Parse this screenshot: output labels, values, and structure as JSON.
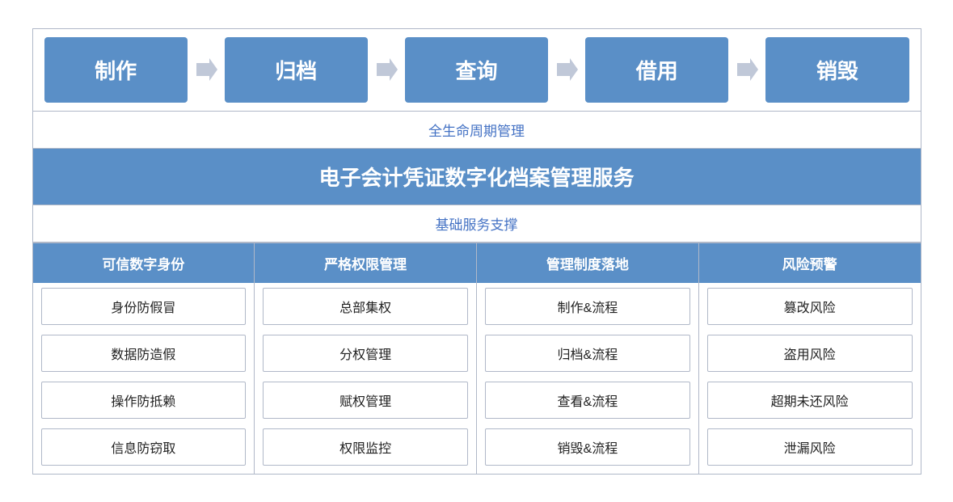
{
  "flow": {
    "steps": [
      "制作",
      "归档",
      "查询",
      "借用",
      "销毁"
    ]
  },
  "lifecycle_label": "全生命周期管理",
  "main_title": "电子会计凭证数字化档案管理服务",
  "base_support_label": "基础服务支撑",
  "columns": [
    {
      "header": "可信数字身份",
      "items": [
        "身份防假冒",
        "数据防造假",
        "操作防抵赖",
        "信息防窃取"
      ]
    },
    {
      "header": "严格权限管理",
      "items": [
        "总部集权",
        "分权管理",
        "赋权管理",
        "权限监控"
      ]
    },
    {
      "header": "管理制度落地",
      "items": [
        "制作&流程",
        "归档&流程",
        "查看&流程",
        "销毁&流程"
      ]
    },
    {
      "header": "风险预警",
      "items": [
        "篡改风险",
        "盗用风险",
        "超期未还风险",
        "泄漏风险"
      ]
    }
  ]
}
